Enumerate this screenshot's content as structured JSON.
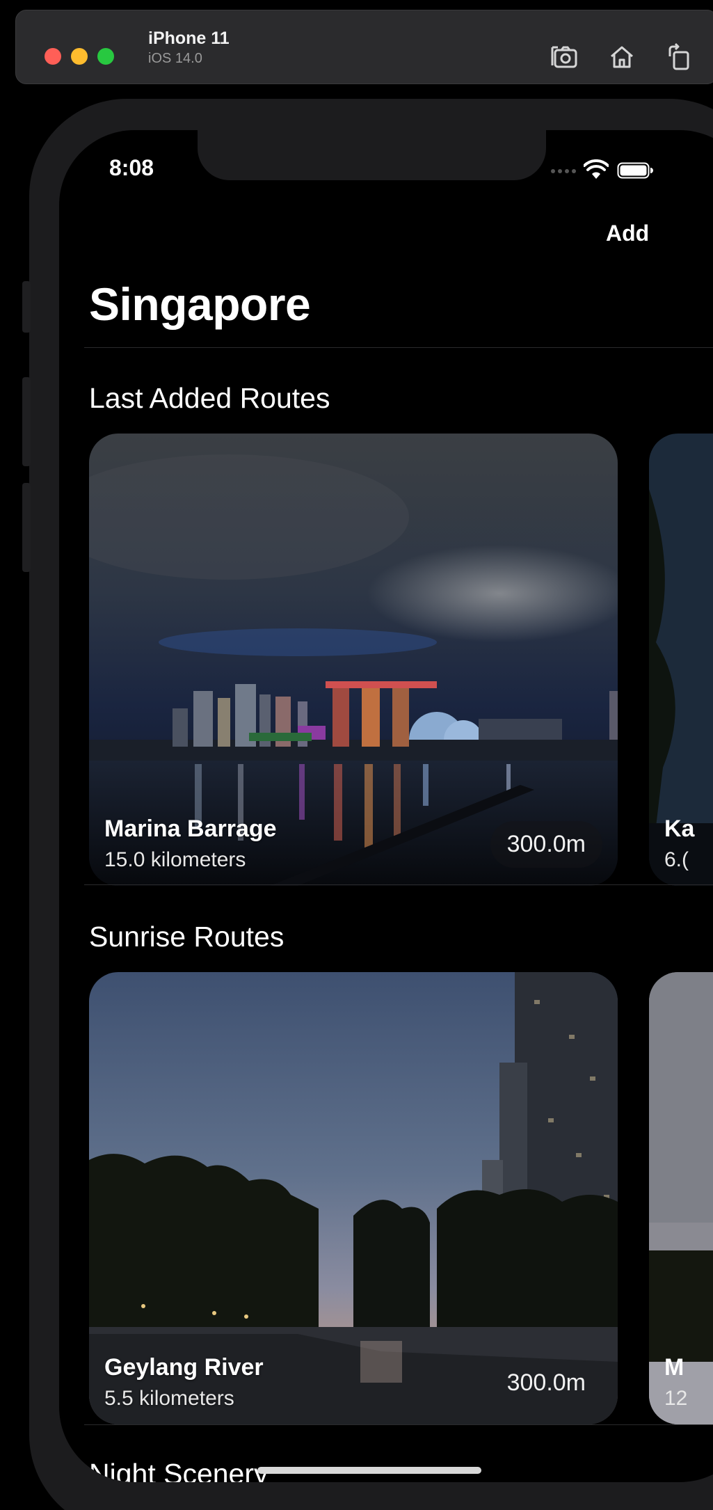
{
  "simulator": {
    "device_name": "iPhone 11",
    "os_version": "iOS 14.0",
    "icons": [
      "screenshot-icon",
      "home-icon",
      "rotate-icon"
    ]
  },
  "status_bar": {
    "time": "8:08",
    "icons": [
      "cellular-icon",
      "wifi-icon",
      "battery-icon"
    ]
  },
  "nav": {
    "add_label": "Add",
    "title": "Singapore"
  },
  "sections": [
    {
      "title": "Last Added Routes",
      "cards": [
        {
          "name": "Marina Barrage",
          "distance": "15.0 kilometers",
          "badge": "300.0m"
        },
        {
          "name": "Ka",
          "distance": "6.("
        }
      ]
    },
    {
      "title": "Sunrise Routes",
      "cards": [
        {
          "name": "Geylang River",
          "distance": "5.5 kilometers",
          "badge": "300.0m"
        },
        {
          "name": "M",
          "distance": "12"
        }
      ]
    },
    {
      "title": "Night Scenery",
      "cards": []
    }
  ],
  "colors": {
    "background": "#000000",
    "phone_frame": "#1c1c1e",
    "text_primary": "#ffffff",
    "close": "#ff5f57",
    "minimize": "#febc2e",
    "zoom": "#28c840"
  }
}
